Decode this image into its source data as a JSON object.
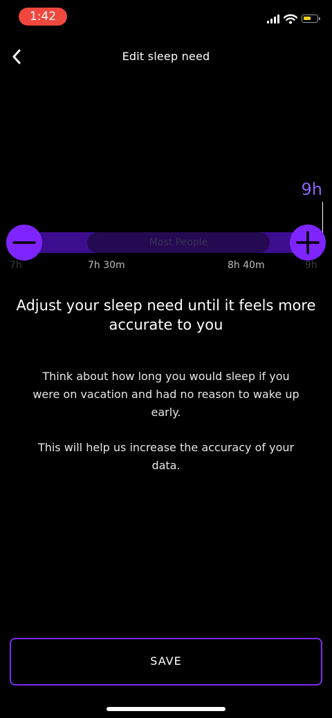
{
  "status_bar": {
    "time": "1:42"
  },
  "header": {
    "title": "Edit sleep need"
  },
  "slider": {
    "current_value": "9h",
    "range_label": "Most People",
    "ticks": [
      "7h",
      "7h 30m",
      "8h 40m",
      "9h"
    ]
  },
  "content": {
    "headline": "Adjust your sleep need until it feels more accurate to you",
    "paragraph1": "Think about how long you would sleep if you were on vacation and had no reason to wake up early.",
    "paragraph2": "This will help us increase the accuracy of your data."
  },
  "footer": {
    "save_label": "SAVE"
  },
  "colors": {
    "accent": "#7e25ff",
    "track": "#3d0d8f",
    "range": "#250a52",
    "value": "#8a63f5"
  }
}
